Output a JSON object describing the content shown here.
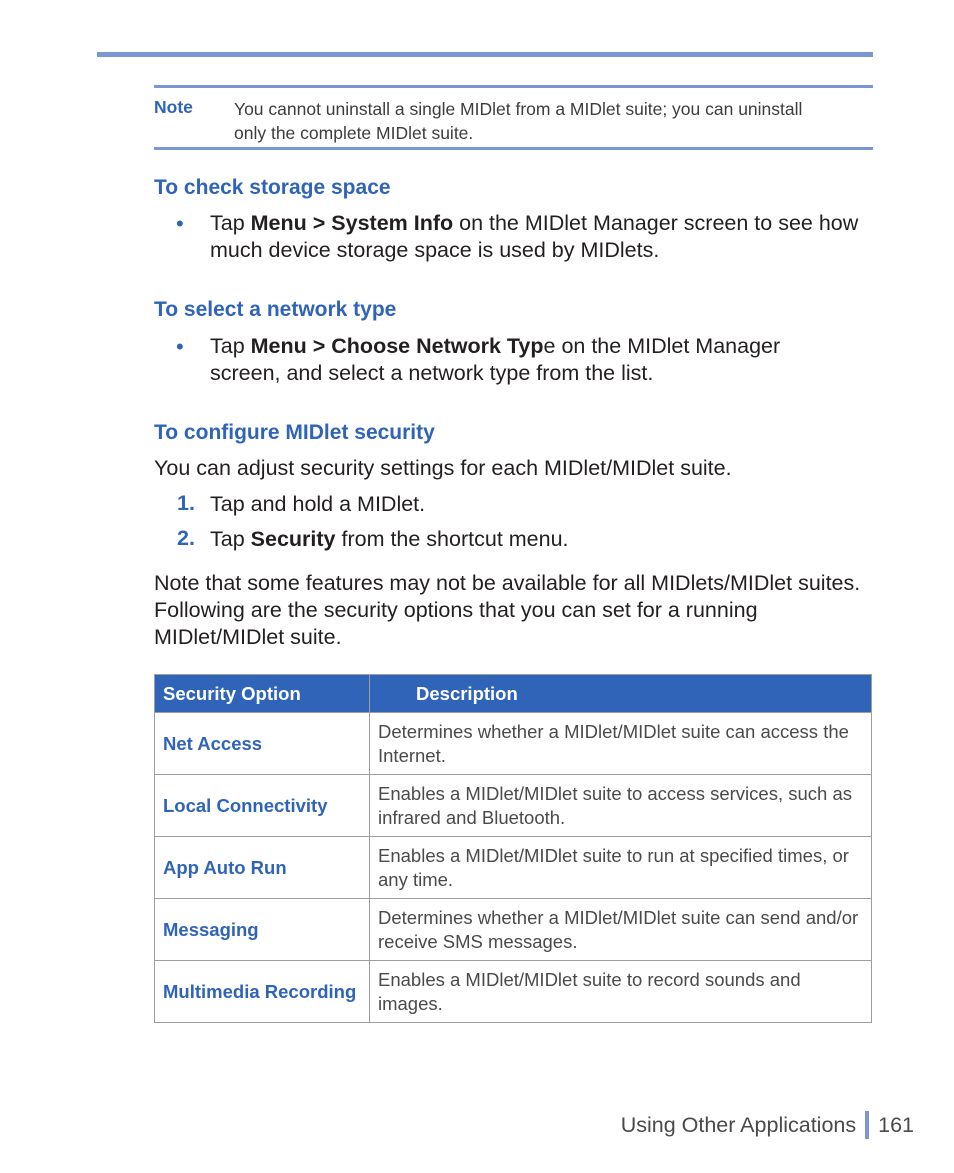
{
  "note": {
    "label": "Note",
    "text": "You cannot uninstall a single MIDlet from a MIDlet suite; you can uninstall only the complete MIDlet suite."
  },
  "sections": {
    "storage": {
      "heading": "To check storage space",
      "bullet": "•",
      "pre": "Tap ",
      "bold": "Menu > System Info",
      "post": " on the MIDlet Manager screen to see how much device storage space is used by MIDlets."
    },
    "network": {
      "heading": "To select a network type",
      "bullet": "•",
      "pre": "Tap ",
      "bold": "Menu > Choose Network Typ",
      "post": "e on the MIDlet Manager screen, and select a network type from the list."
    },
    "security": {
      "heading": "To configure MIDlet security",
      "intro": "You can adjust security settings for each MIDlet/MIDlet suite.",
      "steps": [
        {
          "num": "1.",
          "pre": "Tap and hold a MIDlet.",
          "bold": "",
          "post": ""
        },
        {
          "num": "2.",
          "pre": "Tap ",
          "bold": "Security",
          "post": " from the shortcut menu."
        }
      ],
      "paragraph": "Note that some features may not be available for all MIDlets/MIDlet suites. Following are the security options that you can set for a running MIDlet/MIDlet suite."
    }
  },
  "table": {
    "headers": [
      "Security Option",
      "Description"
    ],
    "rows": [
      {
        "option": "Net Access",
        "description": "Determines whether a MIDlet/MIDlet suite can access the Internet."
      },
      {
        "option": "Local Connectivity",
        "description": "Enables a MIDlet/MIDlet suite to access services, such as infrared and Bluetooth."
      },
      {
        "option": "App Auto Run",
        "description": "Enables a MIDlet/MIDlet suite to run at specified times, or any time."
      },
      {
        "option": "Messaging",
        "description": "Determines whether a MIDlet/MIDlet suite can send and/or receive SMS messages."
      },
      {
        "option": "Multimedia Recording",
        "description": "Enables a MIDlet/MIDlet suite to record sounds and images."
      }
    ]
  },
  "footer": {
    "chapter": "Using Other Applications",
    "page": "161"
  }
}
